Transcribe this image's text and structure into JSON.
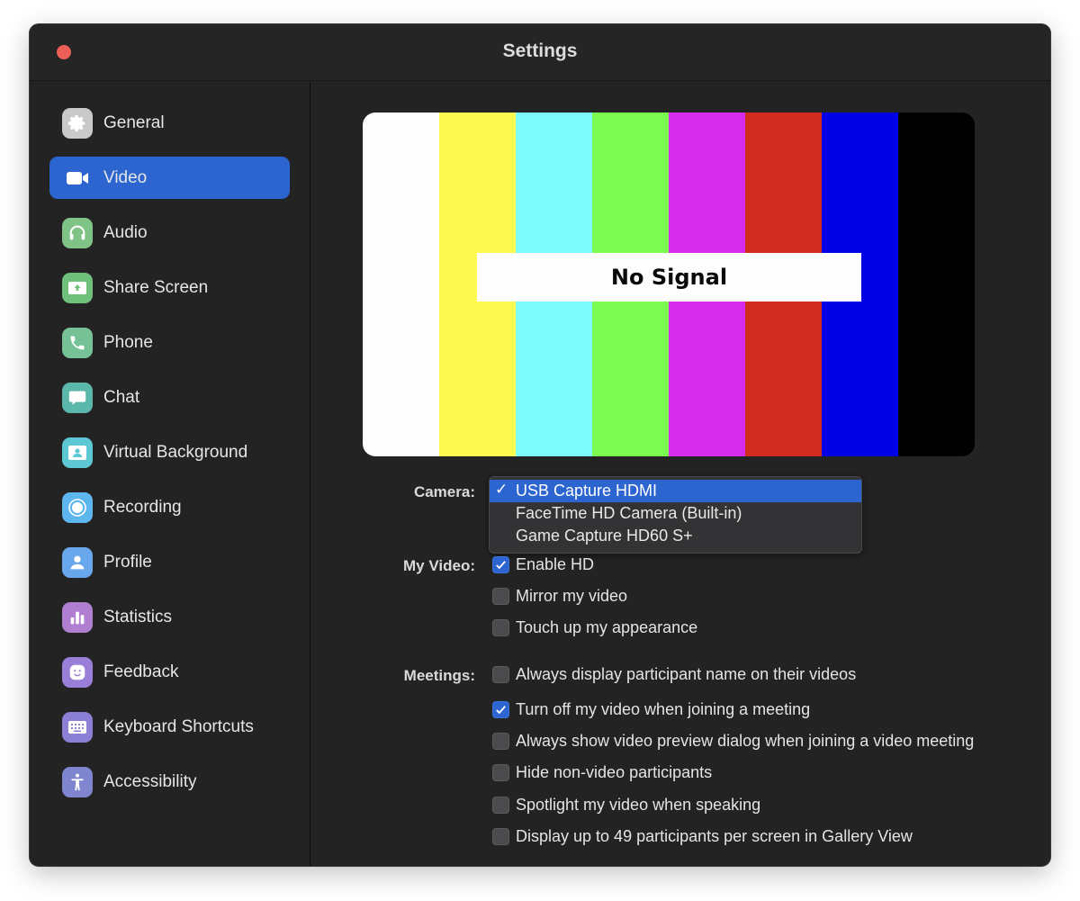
{
  "window": {
    "title": "Settings"
  },
  "sidebar": {
    "items": [
      {
        "label": "General",
        "icon": "gear-icon",
        "color": "#c9c9c9",
        "active": false
      },
      {
        "label": "Video",
        "icon": "video-camera-icon",
        "color": "#2c64d0",
        "active": true
      },
      {
        "label": "Audio",
        "icon": "headphones-icon",
        "color": "#7fc386",
        "active": false
      },
      {
        "label": "Share Screen",
        "icon": "share-screen-icon",
        "color": "#6fc07a",
        "active": false
      },
      {
        "label": "Phone",
        "icon": "phone-icon",
        "color": "#77c196",
        "active": false
      },
      {
        "label": "Chat",
        "icon": "chat-bubble-icon",
        "color": "#5cb8aa",
        "active": false
      },
      {
        "label": "Virtual Background",
        "icon": "virtual-background-icon",
        "color": "#5ec7d4",
        "active": false
      },
      {
        "label": "Recording",
        "icon": "record-icon",
        "color": "#5eb6ef",
        "active": false
      },
      {
        "label": "Profile",
        "icon": "profile-icon",
        "color": "#69a7ec",
        "active": false
      },
      {
        "label": "Statistics",
        "icon": "statistics-icon",
        "color": "#b07fd1",
        "active": false
      },
      {
        "label": "Feedback",
        "icon": "feedback-smiley-icon",
        "color": "#9a7fd9",
        "active": false
      },
      {
        "label": "Keyboard Shortcuts",
        "icon": "keyboard-icon",
        "color": "#8b7fd6",
        "active": false
      },
      {
        "label": "Accessibility",
        "icon": "accessibility-icon",
        "color": "#7f86cf",
        "active": false
      }
    ]
  },
  "preview": {
    "text": "No Signal",
    "bar_colors": [
      "#fdfdfe",
      "#fdfb52",
      "#7efbfb",
      "#7cfb50",
      "#d52ceb",
      "#d22b20",
      "#0101e6",
      "#000000"
    ]
  },
  "camera": {
    "label": "Camera:",
    "selected_check": "✓",
    "options": [
      {
        "label": "USB Capture HDMI",
        "selected": true
      },
      {
        "label": "FaceTime HD Camera (Built-in)",
        "selected": false
      },
      {
        "label": "Game Capture HD60 S+",
        "selected": false
      }
    ]
  },
  "my_video": {
    "label": "My Video:",
    "options": [
      {
        "label": "Enable HD",
        "checked": true
      },
      {
        "label": "Mirror my video",
        "checked": false
      },
      {
        "label": "Touch up my appearance",
        "checked": false
      }
    ]
  },
  "meetings": {
    "label": "Meetings:",
    "options": [
      {
        "label": "Always display participant name on their videos",
        "checked": false
      },
      {
        "label": "Turn off my video when joining a meeting",
        "checked": true
      },
      {
        "label": "Always show video preview dialog when joining a video meeting",
        "checked": false
      },
      {
        "label": "Hide non-video participants",
        "checked": false
      },
      {
        "label": "Spotlight my video when speaking",
        "checked": false
      },
      {
        "label": "Display up to 49 participants per screen in Gallery View",
        "checked": false
      }
    ]
  },
  "accent_color": "#2c64d0"
}
